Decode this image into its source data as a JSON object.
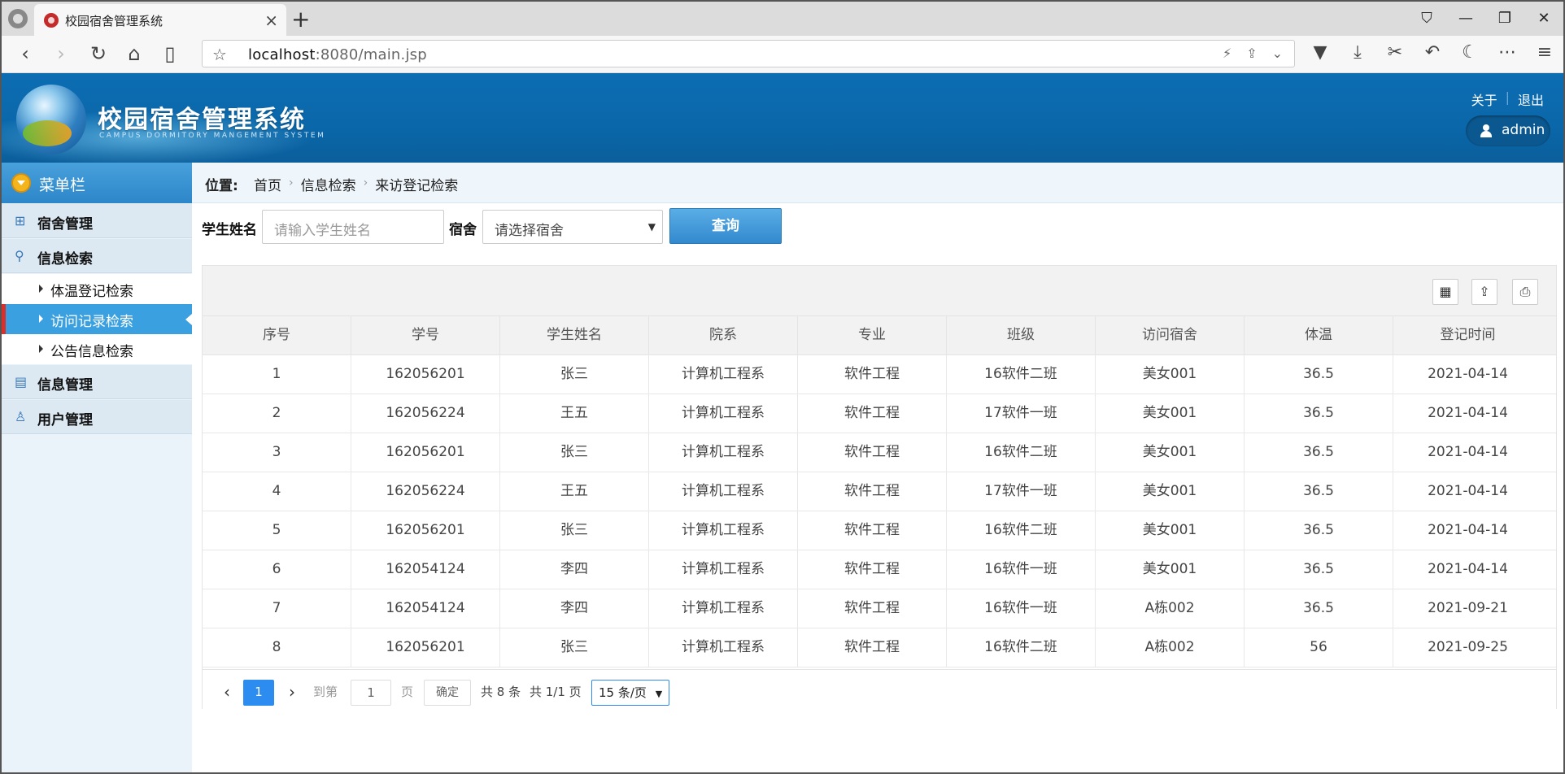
{
  "browser": {
    "tab_title": "校园宿舍管理系统",
    "url_host": "localhost",
    "url_rest": ":8080/main.jsp"
  },
  "header": {
    "title": "校园宿舍管理系统",
    "subtitle": "CAMPUS DORMITORY MANGEMENT SYSTEM",
    "about": "关于",
    "logout": "退出",
    "user": "admin"
  },
  "sidebar": {
    "head": "菜单栏",
    "items": [
      {
        "label": "宿舍管理",
        "icon": "grid-icon"
      },
      {
        "label": "信息检索",
        "icon": "search-icon"
      },
      {
        "label": "信息管理",
        "icon": "list-icon"
      },
      {
        "label": "用户管理",
        "icon": "user-icon"
      }
    ],
    "subitems": [
      "体温登记检索",
      "访问记录检索",
      "公告信息检索"
    ]
  },
  "breadcrumb": {
    "label": "位置:",
    "items": [
      "首页",
      "信息检索",
      "来访登记检索"
    ]
  },
  "search": {
    "name_label": "学生姓名",
    "name_placeholder": "请输入学生姓名",
    "dorm_label": "宿舍",
    "dorm_placeholder": "请选择宿舍",
    "query_button": "查询"
  },
  "table": {
    "columns": [
      "序号",
      "学号",
      "学生姓名",
      "院系",
      "专业",
      "班级",
      "访问宿舍",
      "体温",
      "登记时间"
    ],
    "rows": [
      [
        "1",
        "162056201",
        "张三",
        "计算机工程系",
        "软件工程",
        "16软件二班",
        "美女001",
        "36.5",
        "2021-04-14"
      ],
      [
        "2",
        "162056224",
        "王五",
        "计算机工程系",
        "软件工程",
        "17软件一班",
        "美女001",
        "36.5",
        "2021-04-14"
      ],
      [
        "3",
        "162056201",
        "张三",
        "计算机工程系",
        "软件工程",
        "16软件二班",
        "美女001",
        "36.5",
        "2021-04-14"
      ],
      [
        "4",
        "162056224",
        "王五",
        "计算机工程系",
        "软件工程",
        "17软件一班",
        "美女001",
        "36.5",
        "2021-04-14"
      ],
      [
        "5",
        "162056201",
        "张三",
        "计算机工程系",
        "软件工程",
        "16软件二班",
        "美女001",
        "36.5",
        "2021-04-14"
      ],
      [
        "6",
        "162054124",
        "李四",
        "计算机工程系",
        "软件工程",
        "16软件一班",
        "美女001",
        "36.5",
        "2021-04-14"
      ],
      [
        "7",
        "162054124",
        "李四",
        "计算机工程系",
        "软件工程",
        "16软件一班",
        "A栋002",
        "36.5",
        "2021-09-21"
      ],
      [
        "8",
        "162056201",
        "张三",
        "计算机工程系",
        "软件工程",
        "16软件二班",
        "A栋002",
        "56",
        "2021-09-25"
      ]
    ]
  },
  "pager": {
    "current": "1",
    "goto_label": "到第",
    "goto_value": "1",
    "page_unit": "页",
    "confirm": "确定",
    "total": "共 8 条",
    "pages": "共 1/1 页",
    "page_size": "15 条/页"
  }
}
